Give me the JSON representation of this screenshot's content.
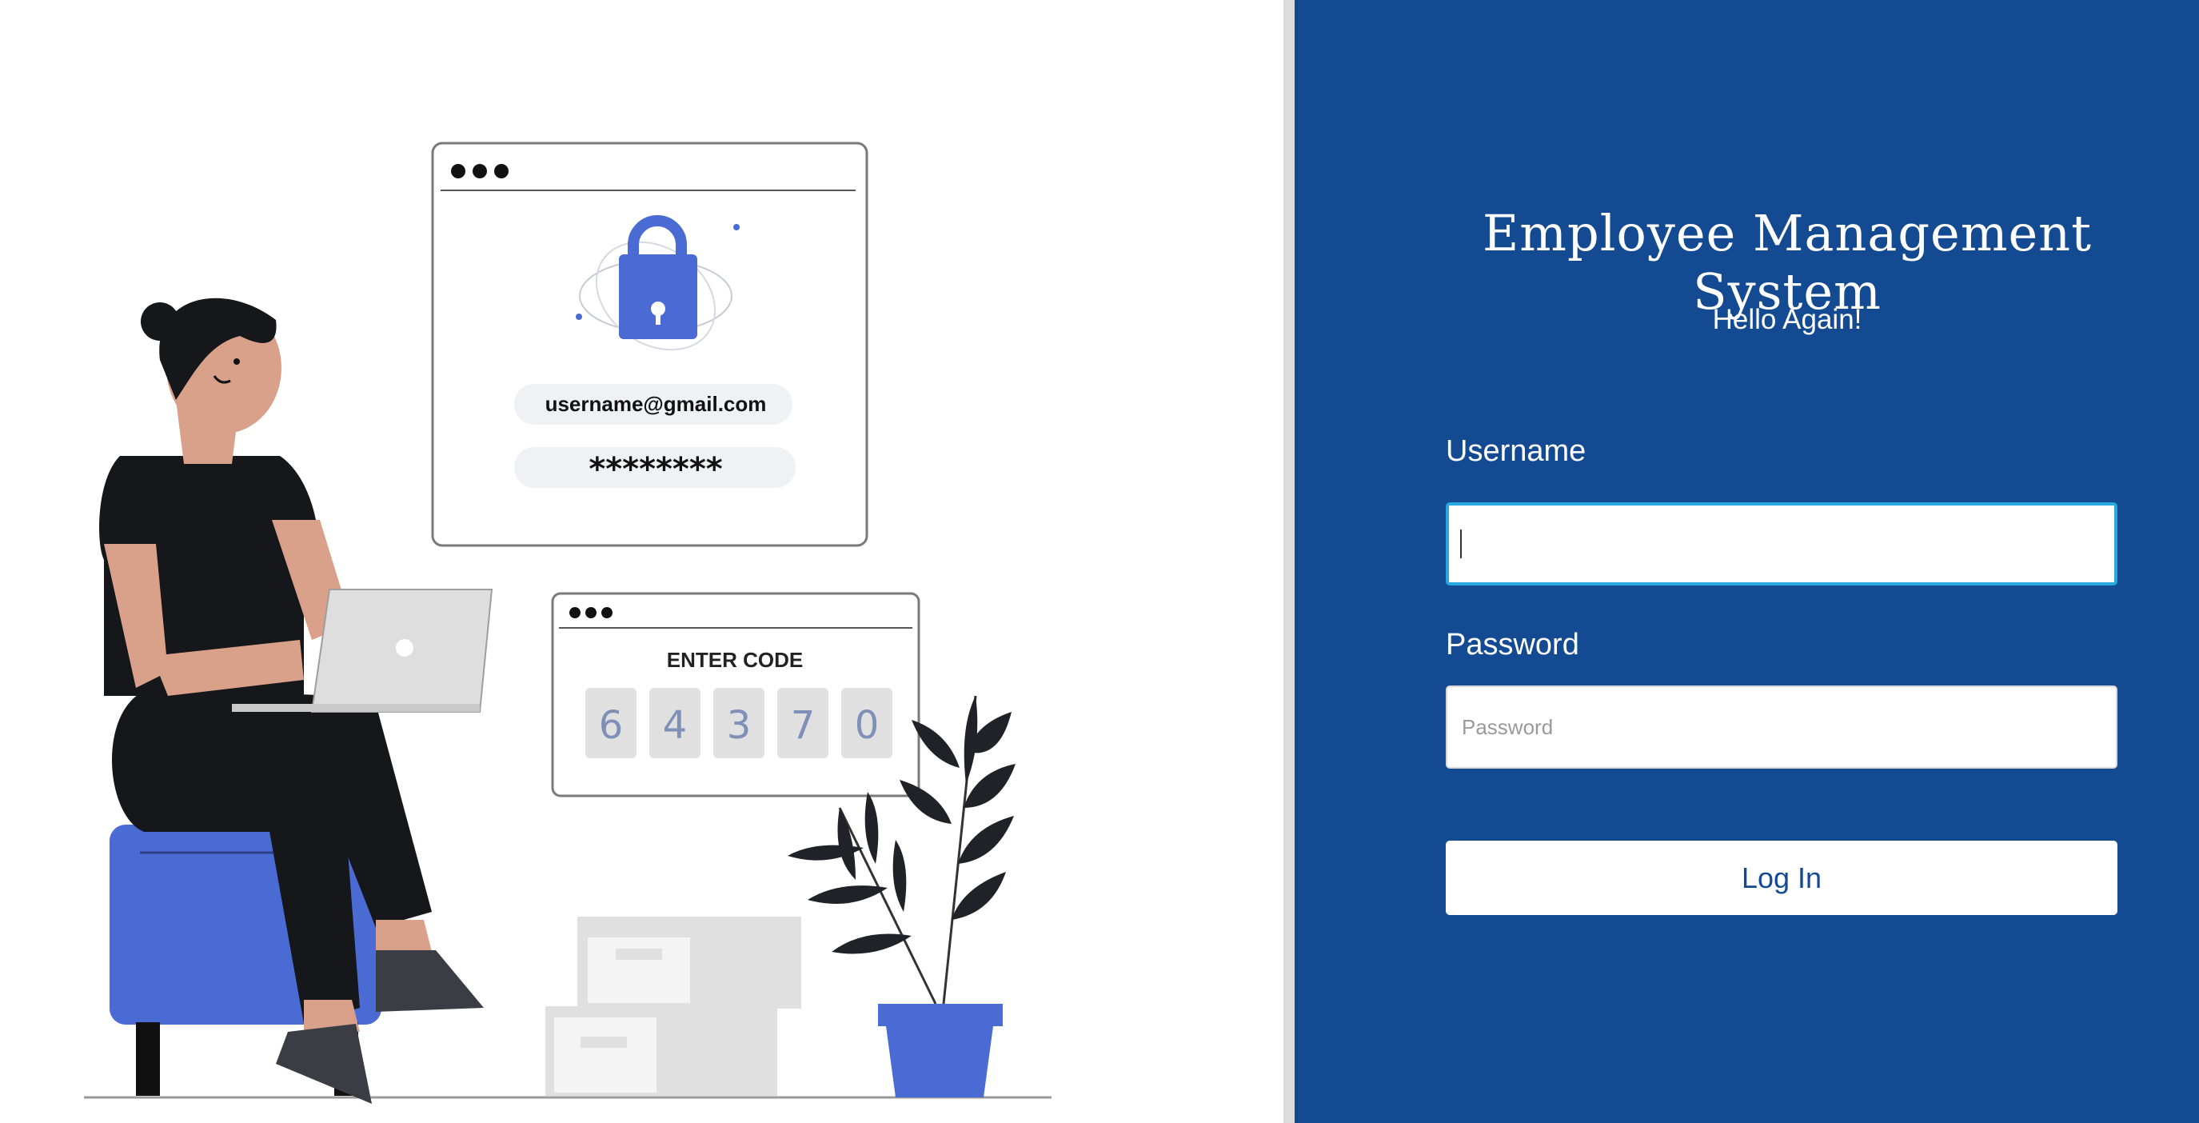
{
  "illustration": {
    "email_text": "username@gmail.com",
    "password_mask": "********",
    "code_heading": "ENTER CODE",
    "code_digits": [
      "6",
      "4",
      "3",
      "7",
      "0"
    ]
  },
  "login": {
    "title": "Employee Management System",
    "subtitle": "Hello Again!",
    "username_label": "Username",
    "username_value": "",
    "password_label": "Password",
    "password_placeholder": "Password",
    "login_button": "Log In"
  },
  "colors": {
    "panel_bg": "#134a91",
    "accent_blue": "#4a6bd4",
    "focus_border": "#29a8e0"
  }
}
